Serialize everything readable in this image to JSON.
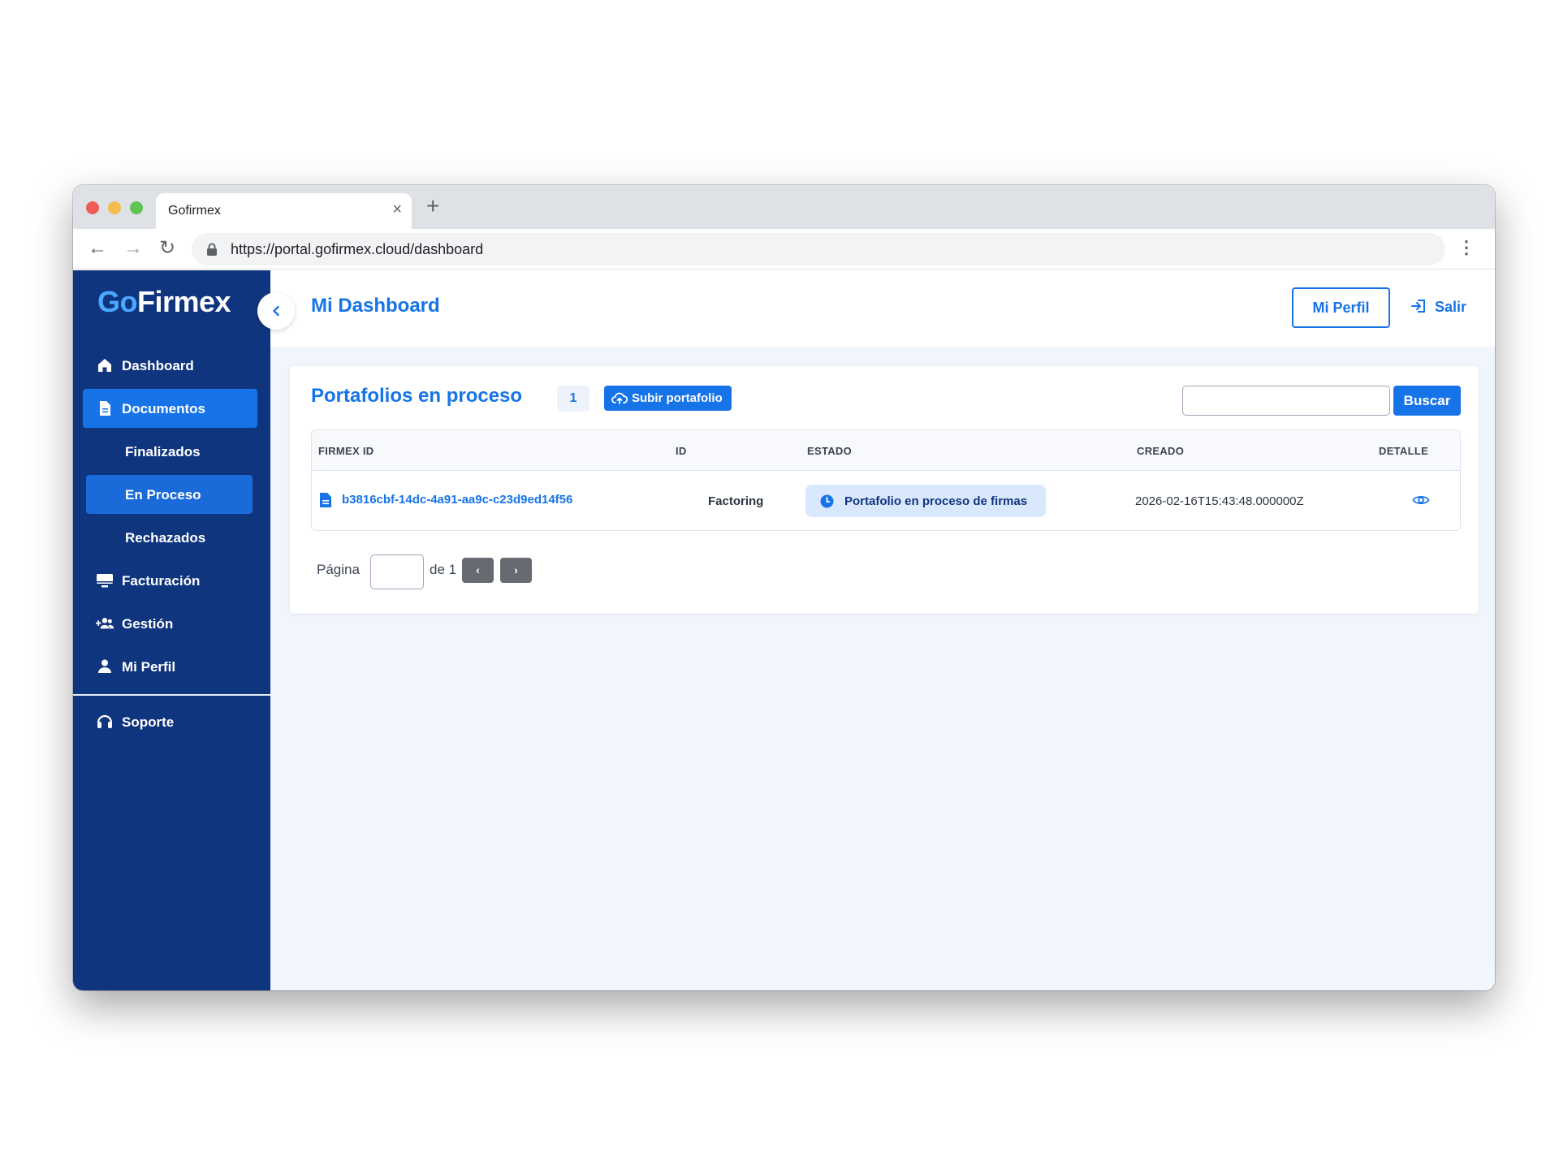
{
  "browser": {
    "tab_title": "Gofirmex",
    "tab_close": "×",
    "new_tab": "+",
    "url": "https://portal.gofirmex.cloud/dashboard",
    "menu": "⋮",
    "back": "←",
    "forward": "→",
    "reload": "↻"
  },
  "brand": {
    "go": "Go",
    "firmex": "Firmex"
  },
  "sidebar": {
    "items": [
      {
        "label": "Dashboard",
        "icon": "home-icon"
      },
      {
        "label": "Documentos",
        "icon": "document-icon",
        "active": true
      },
      {
        "label": "Facturación",
        "icon": "monitor-icon"
      },
      {
        "label": "Gestión",
        "icon": "users-add-icon"
      },
      {
        "label": "Mi Perfil",
        "icon": "user-icon"
      },
      {
        "label": "Soporte",
        "icon": "headset-icon"
      }
    ],
    "subitems": [
      {
        "label": "Finalizados"
      },
      {
        "label": "En Proceso",
        "active": true
      },
      {
        "label": "Rechazados"
      }
    ]
  },
  "header": {
    "title": "Mi Dashboard",
    "profile_button": "Mi Perfil",
    "logout_button": "Salir"
  },
  "card": {
    "title": "Portafolios en proceso",
    "count": "1",
    "upload_button": "Subir portafolio",
    "search_value": "",
    "search_button": "Buscar",
    "columns": [
      "FIRMEX ID",
      "ID",
      "ESTADO",
      "CREADO",
      "DETALLE"
    ],
    "rows": [
      {
        "firmex_id": "b3816cbf-14dc-4a91-aa9c-c23d9ed14f56",
        "id": "Factoring",
        "estado": "Portafolio en proceso de firmas",
        "creado": "2026-02-16T15:43:48.000000Z"
      }
    ],
    "pagination": {
      "label": "Página",
      "current": "",
      "of": "de 1",
      "prev": "‹",
      "next": "›"
    }
  },
  "colors": {
    "primary": "#1774e8",
    "sidebar": "#10357f",
    "background": "#f1f5fc",
    "status_chip": "#d9e8fc"
  }
}
